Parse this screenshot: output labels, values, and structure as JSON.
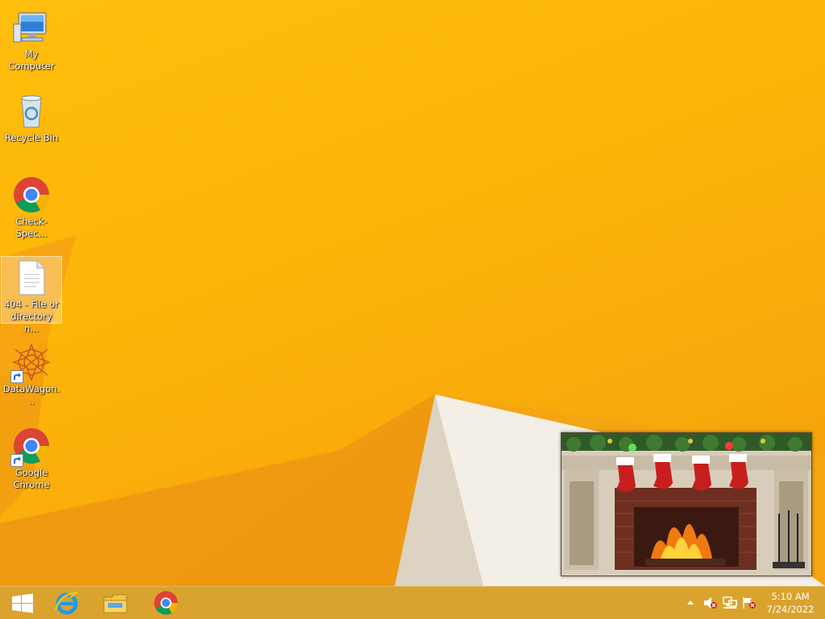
{
  "desktop": {
    "icons": [
      {
        "label": "My Computer",
        "icon": "computer-icon",
        "shortcut": false
      },
      {
        "label": "Recycle Bin",
        "icon": "recycle-bin-icon",
        "shortcut": false
      },
      {
        "label": "Check-Spec...",
        "icon": "chrome-icon",
        "shortcut": false
      },
      {
        "label": "404 - File or directory n...",
        "icon": "document-icon",
        "shortcut": false,
        "selected": true
      },
      {
        "label": "DataWagon...",
        "icon": "datawagon-icon",
        "shortcut": true
      },
      {
        "label": "Google Chrome",
        "icon": "chrome-icon",
        "shortcut": true
      }
    ],
    "widget": {
      "name": "fireplace-widget"
    }
  },
  "taskbar": {
    "pinned": [
      {
        "name": "start-button",
        "icon": "windows-logo-icon"
      },
      {
        "name": "internet-explorer-button",
        "icon": "internet-explorer-icon"
      },
      {
        "name": "file-explorer-button",
        "icon": "file-explorer-icon"
      },
      {
        "name": "chrome-taskbar-button",
        "icon": "chrome-icon"
      }
    ],
    "tray": {
      "icons": [
        "show-hidden-icons-chevron",
        "speaker-muted-icon",
        "network-icon",
        "action-center-flag-icon"
      ],
      "time": "5:10 AM",
      "date": "7/24/2022"
    }
  },
  "colors": {
    "wallpaper": "#fcb509",
    "taskbar": "#d69c1e",
    "chrome_red": "#db4437",
    "chrome_green": "#0f9d58",
    "chrome_yellow": "#f4b400",
    "chrome_blue": "#4285f4"
  }
}
